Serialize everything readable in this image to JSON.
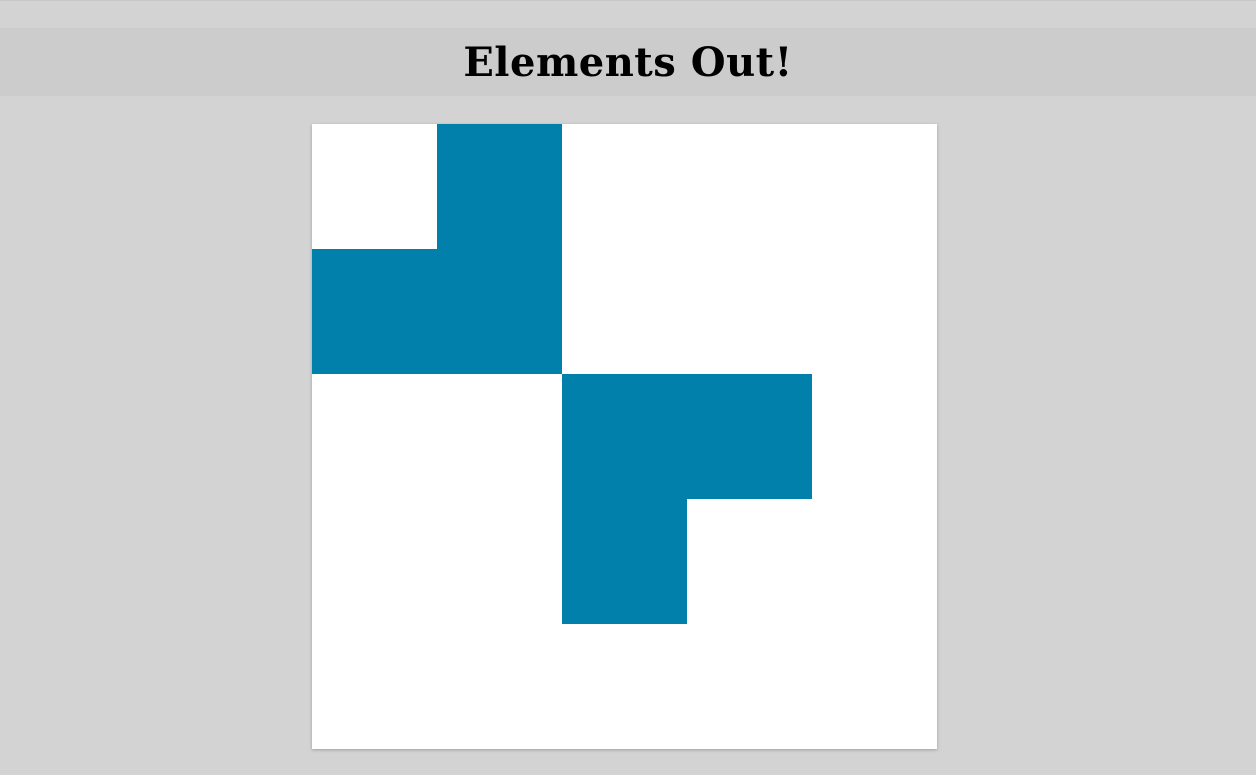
{
  "header": {
    "title": "Elements Out!"
  },
  "board": {
    "rows": 5,
    "cols": 5,
    "on_color": "#0080aa",
    "off_color": "#ffffff",
    "cells": [
      [
        0,
        1,
        0,
        0,
        0
      ],
      [
        1,
        1,
        0,
        0,
        0
      ],
      [
        0,
        0,
        1,
        1,
        0
      ],
      [
        0,
        0,
        1,
        0,
        0
      ],
      [
        0,
        0,
        0,
        0,
        0
      ]
    ]
  }
}
